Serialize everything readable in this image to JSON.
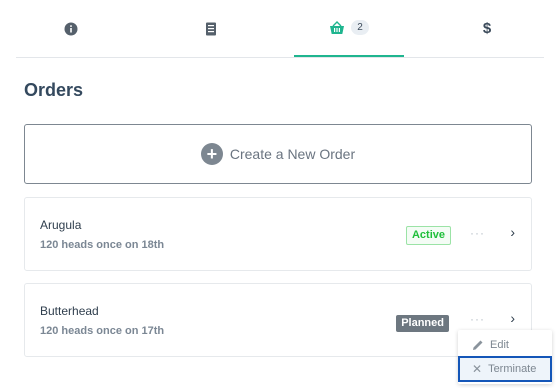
{
  "tabs": [
    {
      "name": "info-icon"
    },
    {
      "name": "receipt-icon"
    },
    {
      "name": "basket-icon",
      "badge": "2"
    },
    {
      "name": "dollar-icon",
      "label": "$"
    }
  ],
  "page_title": "Orders",
  "create_button": {
    "icon": "+",
    "label": "Create a New Order"
  },
  "orders": [
    {
      "name": "Arugula",
      "schedule": "120 heads once on 18th",
      "status": "Active"
    },
    {
      "name": "Butterhead",
      "schedule": "120 heads once on 17th",
      "status": "Planned"
    }
  ],
  "more_glyph": "···",
  "chevron_glyph": "›",
  "context_menu": {
    "edit_label": "Edit",
    "terminate_label": "Terminate",
    "edit_icon": "pencil-icon",
    "terminate_icon": "close-icon",
    "terminate_glyph": "✕"
  },
  "colors": {
    "accent": "#1fb58f",
    "active": "#1fbf3a",
    "planned_bg": "#6d7780",
    "focus_outline": "#1456b8"
  }
}
